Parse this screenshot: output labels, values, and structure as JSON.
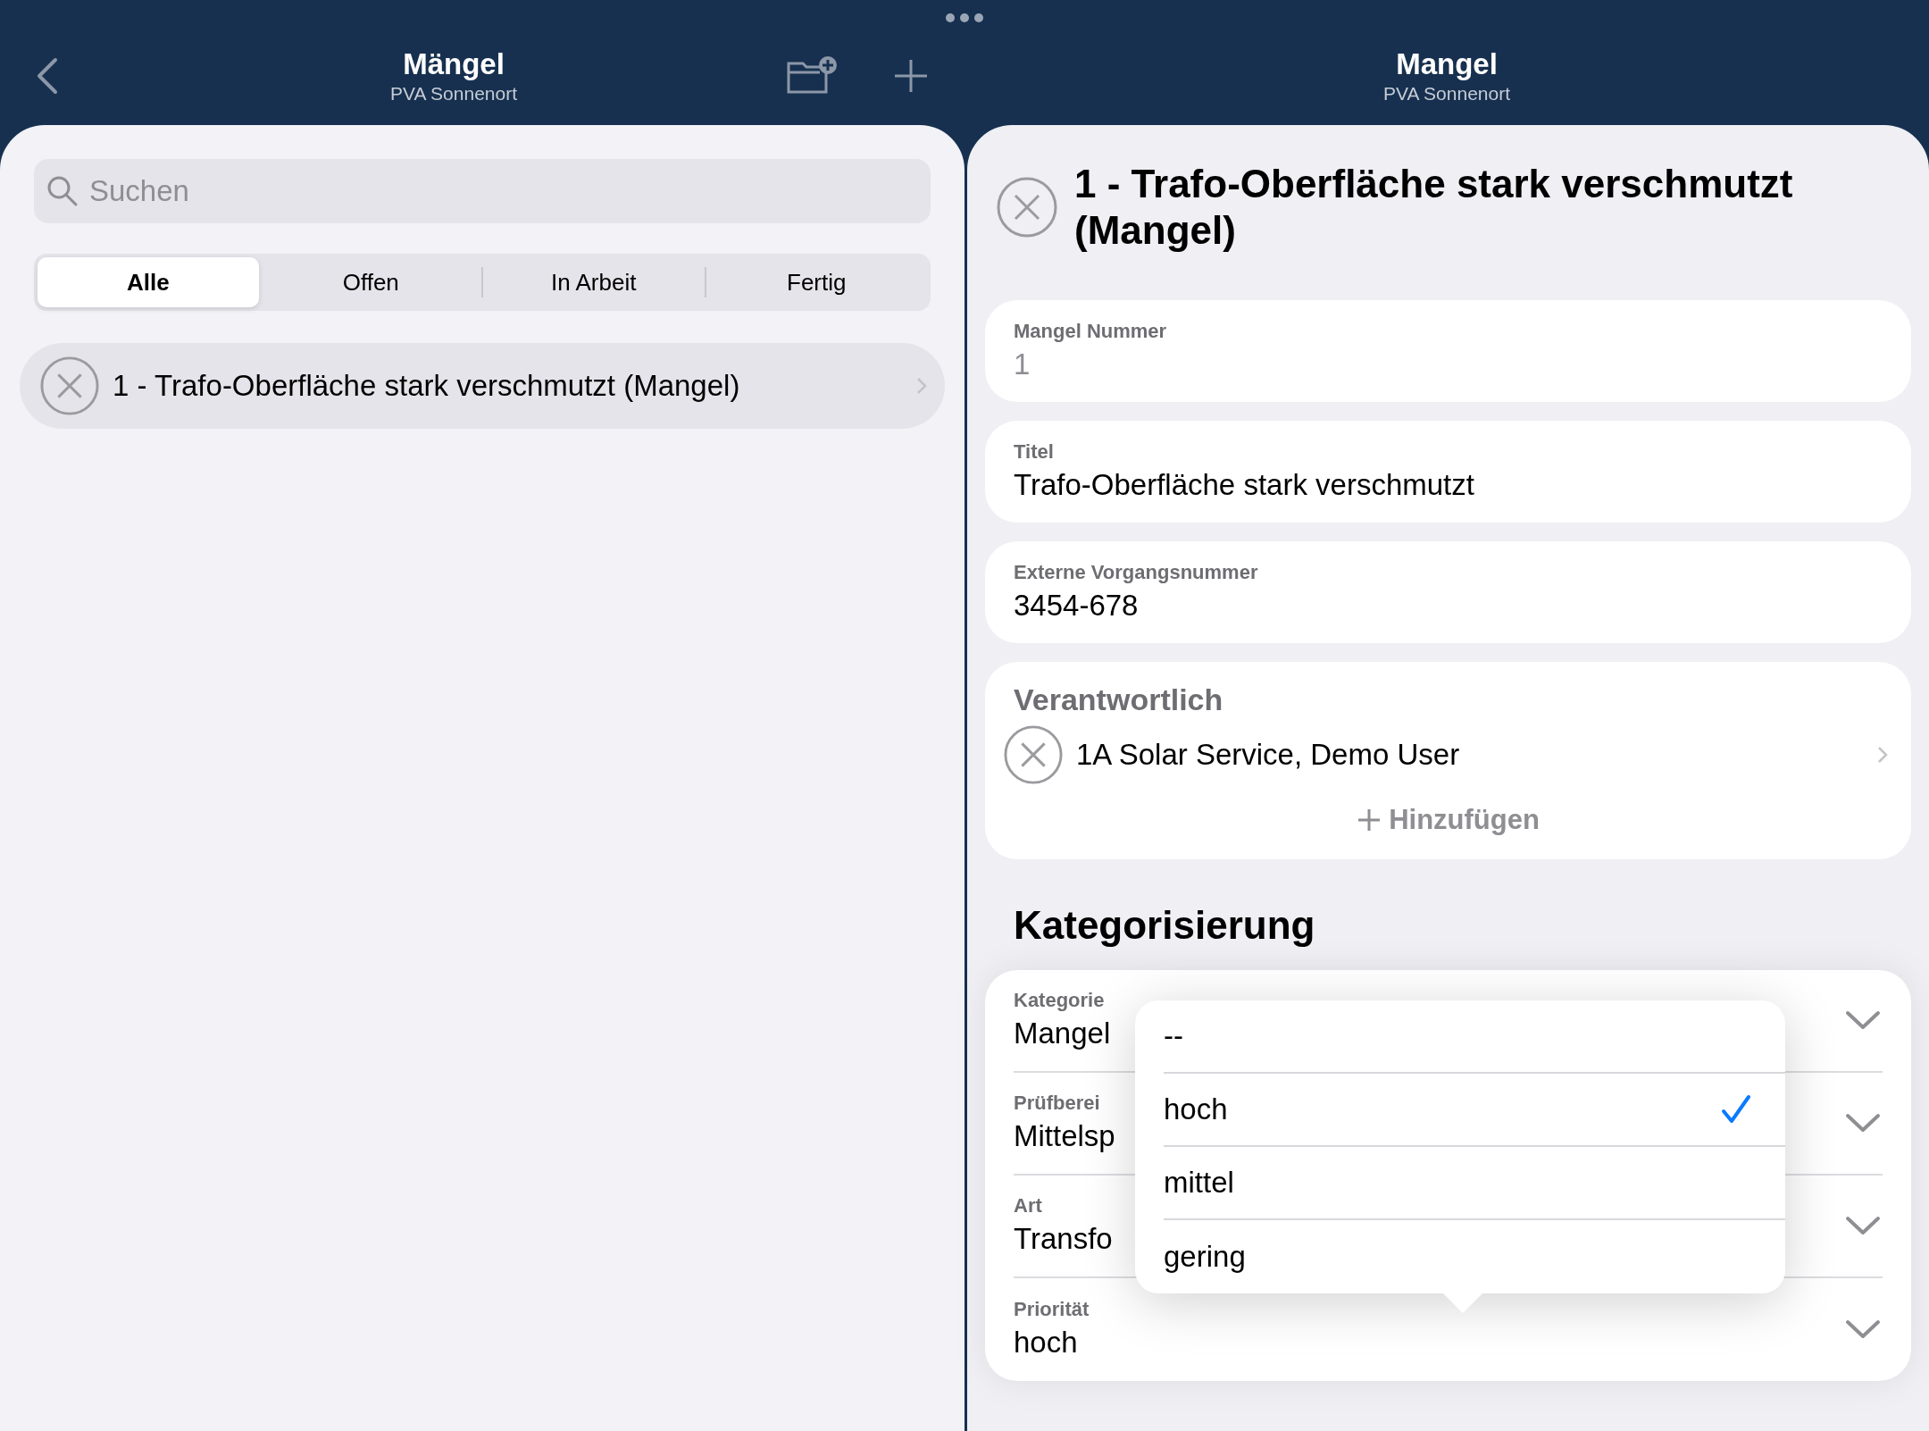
{
  "left_pane": {
    "title": "Mängel",
    "subtitle": "PVA Sonnenort",
    "search": {
      "placeholder": "Suchen"
    },
    "filters": [
      {
        "label": "Alle",
        "selected": true
      },
      {
        "label": "Offen",
        "selected": false
      },
      {
        "label": "In Arbeit",
        "selected": false
      },
      {
        "label": "Fertig",
        "selected": false
      }
    ],
    "items": [
      {
        "text": "1 - Trafo-Oberfläche stark verschmutzt (Mangel)"
      }
    ]
  },
  "right_pane": {
    "title": "Mangel",
    "subtitle": "PVA Sonnenort",
    "heading": "1 - Trafo-Oberfläche stark verschmutzt (Mangel)",
    "fields": [
      {
        "label": "Mangel Nummer",
        "value": "1",
        "disabled": true
      },
      {
        "label": "Titel",
        "value": "Trafo-Oberfläche stark verschmutzt",
        "disabled": false
      },
      {
        "label": "Externe Vorgangsnummer",
        "value": "3454-678",
        "disabled": false
      }
    ],
    "responsible": {
      "label": "Verantwortlich",
      "people": [
        {
          "name": "1A Solar Service, Demo User"
        }
      ],
      "add_button": "Hinzufügen"
    },
    "section_title": "Kategorisierung",
    "categories": [
      {
        "label": "Kategorie",
        "value": "Mangel"
      },
      {
        "label": "Prüfberei",
        "value": "Mittelsp"
      },
      {
        "label": "Art",
        "value": "Transfo"
      },
      {
        "label": "Priorität",
        "value": "hoch"
      }
    ],
    "dropdown": {
      "options": [
        {
          "label": "--",
          "selected": false
        },
        {
          "label": "hoch",
          "selected": true
        },
        {
          "label": "mittel",
          "selected": false
        },
        {
          "label": "gering",
          "selected": false
        }
      ]
    }
  }
}
